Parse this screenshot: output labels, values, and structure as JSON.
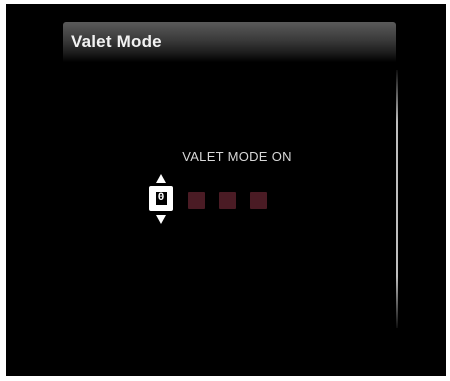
{
  "header": {
    "title": "Valet Mode"
  },
  "main": {
    "status_text": "VALET MODE ON",
    "pin": {
      "current_digit": "0",
      "filled_count": 0,
      "total_digits": 4
    }
  },
  "colors": {
    "background": "#000000",
    "text": "#d8d8d8",
    "pin_slot": "#4a1b24",
    "selector": "#ffffff"
  },
  "icons": {
    "up": "arrow-up-icon",
    "down": "arrow-down-icon"
  }
}
